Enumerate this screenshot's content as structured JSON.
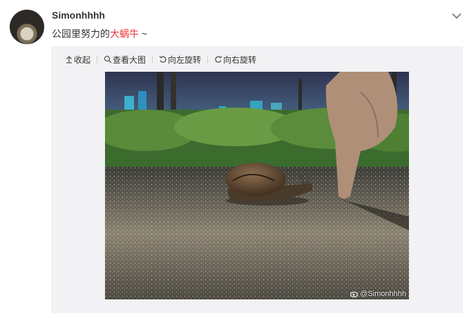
{
  "author": {
    "name": "Simonhhhh"
  },
  "post": {
    "text_before": "公园里努力的",
    "text_highlight": "大蜗牛",
    "text_after": " ~"
  },
  "toolbar": {
    "collapse": "收起",
    "view_large": "查看大图",
    "rotate_left": "向左旋转",
    "rotate_right": "向右旋转"
  },
  "photo": {
    "watermark": "@Simonhhhh"
  },
  "colors": {
    "highlight": "#e33333",
    "media_bg": "#f2f2f5"
  }
}
